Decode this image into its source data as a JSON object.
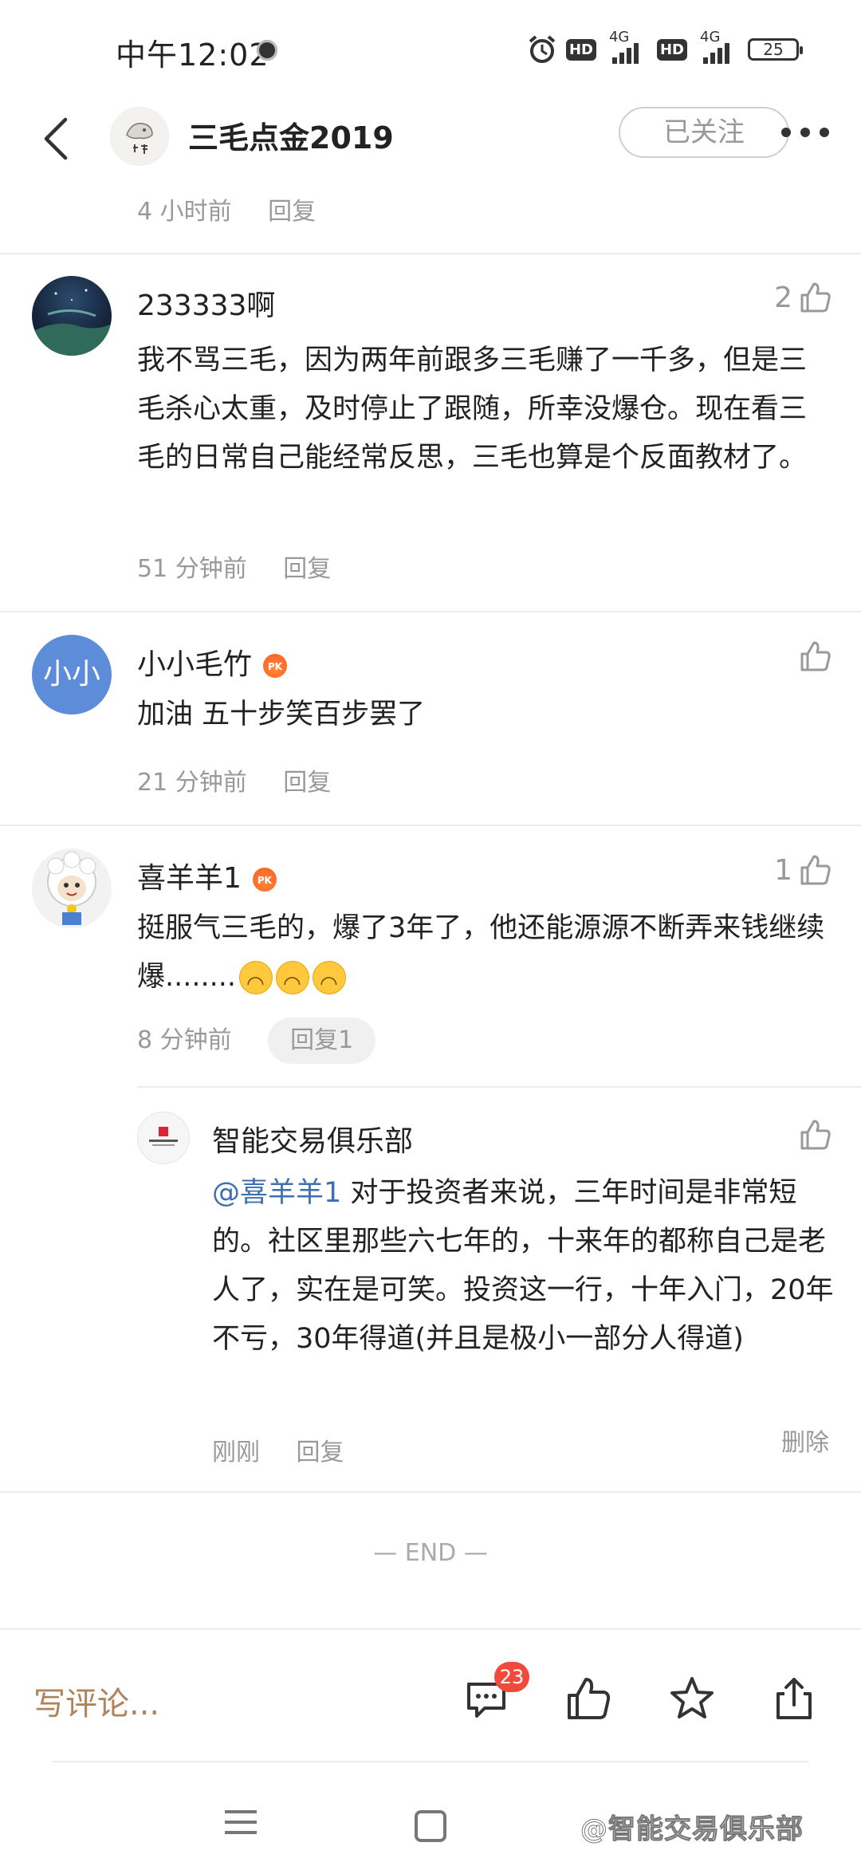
{
  "status_bar": {
    "time": "中午12:02",
    "hd1": "HD",
    "net1": "4G",
    "hd2": "HD",
    "net2": "4G",
    "battery": "25"
  },
  "header": {
    "title": "三毛点金2019",
    "follow_label": "已关注"
  },
  "top_meta": {
    "time": "4 小时前",
    "reply": "回复"
  },
  "comments": [
    {
      "author": "233333啊",
      "likes": "2",
      "text": "我不骂三毛，因为两年前跟多三毛赚了一千多，但是三毛杀心太重，及时停止了跟随，所幸没爆仓。现在看三毛的日常自己能经常反思，三毛也算是个反面教材了。",
      "time": "51 分钟前",
      "reply": "回复"
    },
    {
      "author": "小小毛竹",
      "avatar_text": "小小",
      "badge": "PK",
      "text": "加油 五十步笑百步罢了",
      "time": "21 分钟前",
      "reply": "回复"
    },
    {
      "author": "喜羊羊1",
      "badge": "PK",
      "likes": "1",
      "text": "挺服气三毛的，爆了3年了，他还能源源不断弄来钱继续爆........",
      "time": "8 分钟前",
      "reply": "回复1",
      "sub_reply": {
        "author": "智能交易俱乐部",
        "mention": "@喜羊羊1",
        "text": " 对于投资者来说，三年时间是非常短的。社区里那些六七年的，十来年的都称自己是老人了，实在是可笑。投资这一行，十年入门，20年不亏，30年得道(并且是极小一部分人得道)",
        "time": "刚刚",
        "reply": "回复",
        "delete": "删除"
      }
    }
  ],
  "end_mark": "— END —",
  "bottom_bar": {
    "write_comment": "写评论...",
    "comment_count": "23"
  },
  "watermark": "@智能交易俱乐部"
}
